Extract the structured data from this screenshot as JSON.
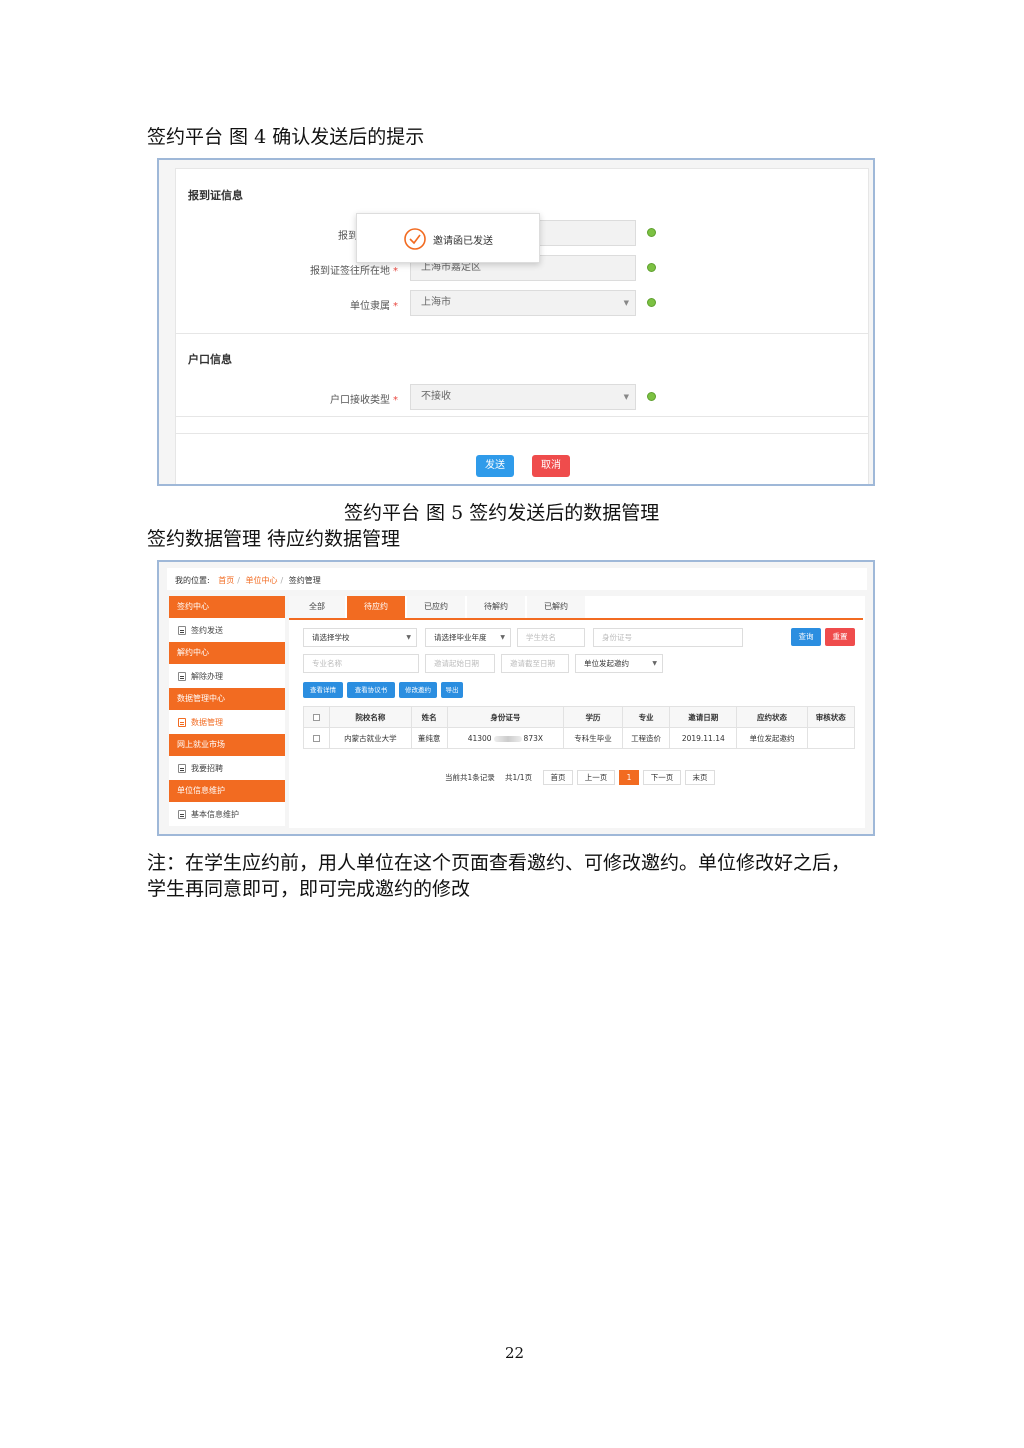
{
  "doc": {
    "fig4_heading": "签约平台 图 4 确认发送后的提示",
    "fig5_caption": "签约平台 图 5 签约发送后的数据管理",
    "section_heading": "签约数据管理 待应约数据管理",
    "note_line1": "注：在学生应约前，用人单位在这个页面查看邀约、可修改邀约。单位修改好之后，",
    "note_line2": "学生再同意即可，即可完成邀约的修改",
    "page_number": "22"
  },
  "fig4": {
    "section1_title": "报到证信息",
    "row1_label_visible": "报到",
    "row2_label": "报到证签往所在地",
    "row2_value": "上海市嘉定区",
    "row3_label": "单位隶属",
    "row3_value": "上海市",
    "section2_title": "户口信息",
    "row4_label": "户口接收类型",
    "row4_value": "不接收",
    "required_mark": "*",
    "toast_text": "邀请函已发送",
    "send_button": "发送",
    "cancel_button": "取消",
    "colors": {
      "send": "#2f9bea",
      "cancel": "#ef4c4c",
      "ok": "#7cc142",
      "toast_icon": "#f26b21"
    }
  },
  "fig5": {
    "breadcrumb": {
      "prefix": "我的位置:",
      "home": "首页",
      "unit_center": "单位中心",
      "current": "签约管理"
    },
    "sidebar": [
      {
        "type": "head",
        "label": "签约中心"
      },
      {
        "type": "item",
        "label": "签约发送",
        "icon": "document-icon"
      },
      {
        "type": "head",
        "label": "解约中心"
      },
      {
        "type": "item",
        "label": "解除办理",
        "icon": "document-icon"
      },
      {
        "type": "head",
        "label": "数据管理中心"
      },
      {
        "type": "item",
        "label": "数据管理",
        "icon": "document-icon",
        "active": true
      },
      {
        "type": "head",
        "label": "网上就业市场"
      },
      {
        "type": "item",
        "label": "我要招聘",
        "icon": "document-icon"
      },
      {
        "type": "head",
        "label": "单位信息维护"
      },
      {
        "type": "item",
        "label": "基本信息维护",
        "icon": "id-card-icon"
      }
    ],
    "tabs": [
      "全部",
      "待应约",
      "已应约",
      "待解约",
      "已解约"
    ],
    "active_tab": "待应约",
    "filters": {
      "school": "请选择学校",
      "grad_year": "请选择毕业年度",
      "student_name": "学生姓名",
      "id_number": "身份证号",
      "major": "专业名称",
      "start_date": "邀请起始日期",
      "end_date": "邀请截至日期",
      "initiator": "单位发起邀约",
      "search": "查询",
      "reset": "重置"
    },
    "actions": [
      "查看详情",
      "查看协议书",
      "修改邀约",
      "导出"
    ],
    "table": {
      "headers": [
        "院校名称",
        "姓名",
        "身份证号",
        "学历",
        "专业",
        "邀请日期",
        "应约状态",
        "审核状态"
      ],
      "rows": [
        {
          "school": "内蒙古就业大学",
          "name": "董纯意",
          "id_prefix": "41300",
          "id_suffix": "873X",
          "education": "专科生毕业",
          "major": "工程造价",
          "date": "2019.11.14",
          "status": "单位发起邀约",
          "audit": ""
        }
      ]
    },
    "pagination": {
      "summary": "当前共1条记录",
      "pages": "共1/1页",
      "first": "首页",
      "prev": "上一页",
      "current": "1",
      "next": "下一页",
      "last": "末页"
    },
    "colors": {
      "accent": "#f26b21",
      "blue": "#2b8ee0",
      "red": "#ef4c4c"
    }
  }
}
